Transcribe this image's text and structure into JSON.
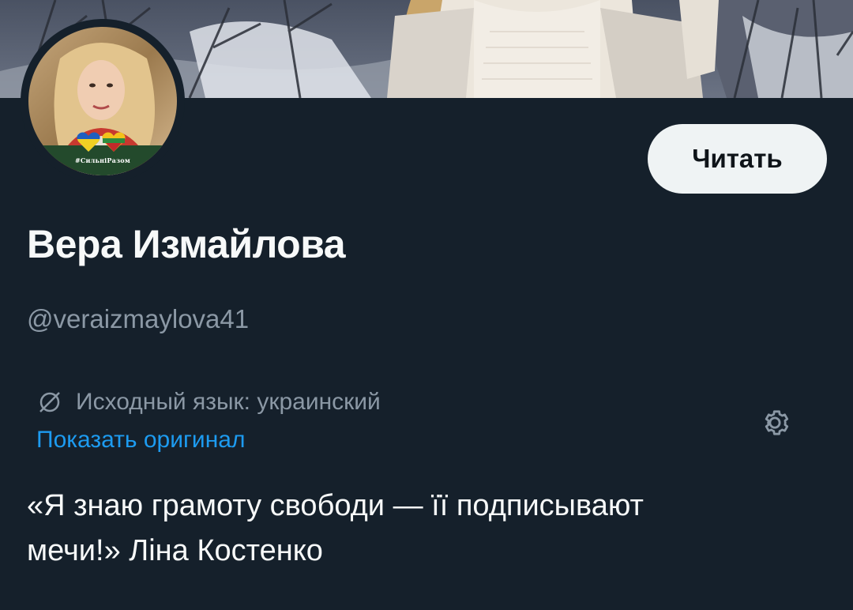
{
  "profile": {
    "display_name": "Вера Измайлова",
    "handle": "@veraizmaylova41",
    "avatar_tag": "#СильніРазом",
    "follow_label": "Читать",
    "translation": {
      "source_language": "Исходный язык: украинский",
      "show_original": "Показать оригинал"
    },
    "bio": {
      "line1": "«Я знаю грамоту свободи — її подписывают",
      "line2": "мечи!» Ліна Костенко"
    }
  },
  "icons": {
    "translate": "translate-icon",
    "settings": "gear-icon"
  },
  "colors": {
    "background": "#15202b",
    "primary_text": "#f7f9f9",
    "secondary_text": "#8b98a5",
    "link": "#1d9bf0",
    "button_bg": "#eff3f4"
  }
}
